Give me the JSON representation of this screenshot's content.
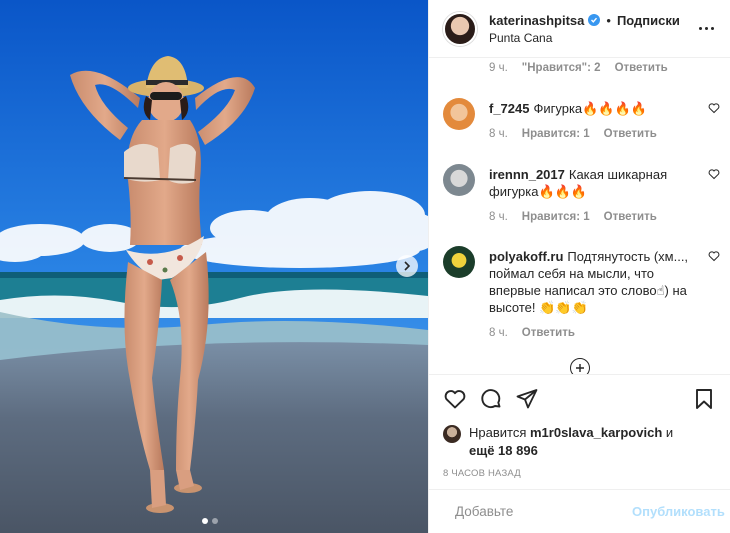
{
  "post": {
    "author": "katerinashpitsa",
    "separator": "•",
    "follow_label": "Подписки",
    "location": "Punta Cana",
    "carousel": {
      "total_slides": 2,
      "active_slide": 1
    }
  },
  "comments": [
    {
      "meta": {
        "time": "9 ч.",
        "likes": "\"Нравится\": 2",
        "reply": "Ответить"
      }
    },
    {
      "user": "f_7245",
      "text": "Фигурка🔥🔥🔥🔥",
      "meta": {
        "time": "8 ч.",
        "likes": "Нравится: 1",
        "reply": "Ответить"
      }
    },
    {
      "user": "irennn_2017",
      "text": "Какая шикарная фигурка🔥🔥🔥",
      "meta": {
        "time": "8 ч.",
        "likes": "Нравится: 1",
        "reply": "Ответить"
      }
    },
    {
      "user": "polyakoff.ru",
      "text": "Подтянутость (хм..., поймал себя на мысли, что впервые написал это слово☝) на высоте! 👏👏👏",
      "meta": {
        "time": "8 ч.",
        "reply": "Ответить"
      }
    }
  ],
  "likes": {
    "prefix": "Нравится",
    "user": "m1r0slava_karpovich",
    "and": "и",
    "others": "ещё 18 896"
  },
  "timestamp": "8 ЧАСОВ НАЗАД",
  "add_comment": {
    "placeholder": "Добавьте",
    "publish_label": "Опубликовать"
  },
  "colors": {
    "accent": "#3897f0",
    "publish_disabled": "#b2dffc",
    "secondary_text": "#8e8e8e",
    "sky": "#1e6fd6",
    "sea": "#1d7f93"
  }
}
